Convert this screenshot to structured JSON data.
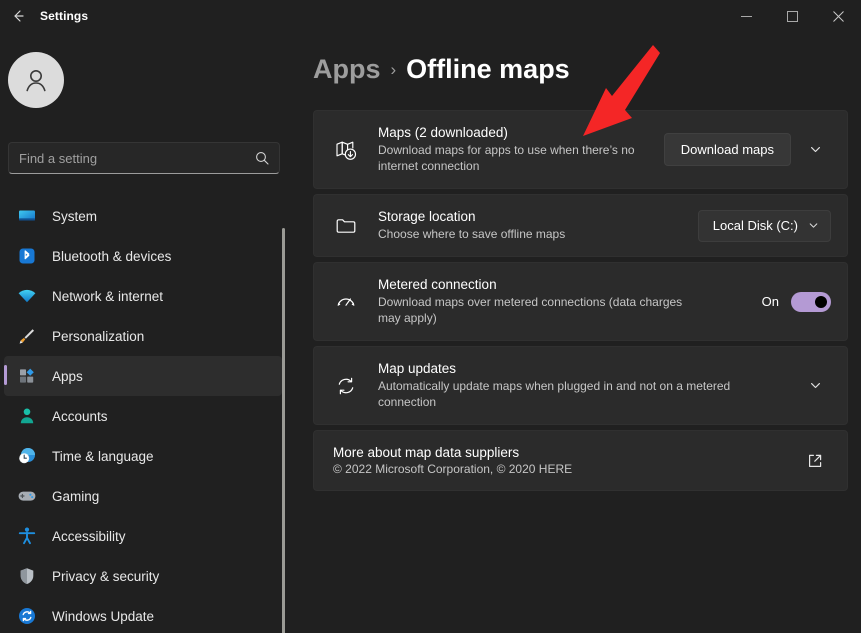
{
  "window": {
    "app_title": "Settings",
    "back_icon": "back-arrow-icon",
    "minimize_label": "—",
    "maximize_label": "☐",
    "close_label": "✕"
  },
  "sidebar": {
    "avatar_icon": "user-avatar-icon",
    "search": {
      "placeholder": "Find a setting",
      "value": "",
      "icon": "search-icon"
    },
    "items": [
      {
        "label": "System",
        "icon": "monitor-icon",
        "selected": false
      },
      {
        "label": "Bluetooth & devices",
        "icon": "bluetooth-icon",
        "selected": false
      },
      {
        "label": "Network & internet",
        "icon": "wifi-icon",
        "selected": false
      },
      {
        "label": "Personalization",
        "icon": "paintbrush-icon",
        "selected": false
      },
      {
        "label": "Apps",
        "icon": "apps-grid-icon",
        "selected": true
      },
      {
        "label": "Accounts",
        "icon": "person-icon",
        "selected": false
      },
      {
        "label": "Time & language",
        "icon": "clock-globe-icon",
        "selected": false
      },
      {
        "label": "Gaming",
        "icon": "gamepad-icon",
        "selected": false
      },
      {
        "label": "Accessibility",
        "icon": "accessibility-person-icon",
        "selected": false
      },
      {
        "label": "Privacy & security",
        "icon": "shield-icon",
        "selected": false
      },
      {
        "label": "Windows Update",
        "icon": "refresh-circle-icon",
        "selected": false
      }
    ]
  },
  "main": {
    "breadcrumb": {
      "parent": "Apps",
      "separator": "›",
      "current": "Offline maps"
    },
    "cards": [
      {
        "icon": "map-download-icon",
        "title": "Maps (2 downloaded)",
        "subtitle": "Download maps for apps to use when there’s no internet connection",
        "button_label": "Download maps",
        "expand_icon": "chevron-down-icon"
      },
      {
        "icon": "folder-icon",
        "title": "Storage location",
        "subtitle": "Choose where to save offline maps",
        "dropdown_value": "Local Disk (C:)",
        "dropdown_icon": "chevron-down-icon"
      },
      {
        "icon": "gauge-icon",
        "title": "Metered connection",
        "subtitle": "Download maps over metered connections (data charges may apply)",
        "toggle_label": "On",
        "toggle_state": "on"
      },
      {
        "icon": "sync-refresh-icon",
        "title": "Map updates",
        "subtitle": "Automatically update maps when plugged in and not on a metered connection",
        "expand_icon": "chevron-down-icon"
      },
      {
        "icon": "",
        "title": "More about map data suppliers",
        "subtitle": "© 2022 Microsoft Corporation, © 2020 HERE",
        "link_icon": "external-link-icon"
      }
    ]
  },
  "annotation": {
    "arrow_color": "#f42626",
    "arrow_name": "red-pointer-arrow"
  },
  "colors": {
    "background": "#202020",
    "card": "#2b2b2b",
    "accent": "#b49ad4",
    "text_primary": "#ffffff",
    "text_secondary": "#c6c6c6"
  }
}
